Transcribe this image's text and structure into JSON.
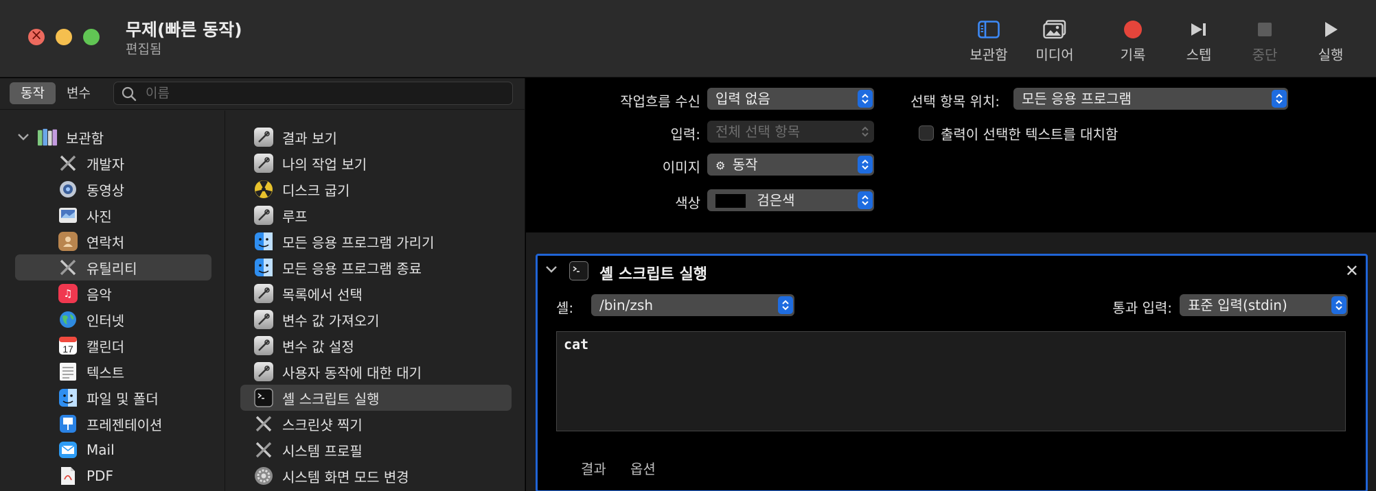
{
  "window": {
    "title": "무제(빠른 동작)",
    "subtitle": "편집됨"
  },
  "toolbar": {
    "library": "보관함",
    "media": "미디어",
    "record": "기록",
    "step": "스텝",
    "stop": "중단",
    "run": "실행"
  },
  "library": {
    "tabs": [
      "동작",
      "변수"
    ],
    "active_tab": "동작",
    "search_placeholder": "이름",
    "root_label": "보관함",
    "categories": [
      {
        "label": "개발자",
        "icon": "tools-icon"
      },
      {
        "label": "동영상",
        "icon": "movie-icon"
      },
      {
        "label": "사진",
        "icon": "photos-icon"
      },
      {
        "label": "연락처",
        "icon": "contacts-icon"
      },
      {
        "label": "유틸리티",
        "icon": "tools-icon",
        "selected": true
      },
      {
        "label": "음악",
        "icon": "music-icon"
      },
      {
        "label": "인터넷",
        "icon": "globe-icon"
      },
      {
        "label": "캘린더",
        "icon": "calendar-icon"
      },
      {
        "label": "텍스트",
        "icon": "text-icon"
      },
      {
        "label": "파일 및 폴더",
        "icon": "finder-icon"
      },
      {
        "label": "프레젠테이션",
        "icon": "keynote-icon"
      },
      {
        "label": "Mail",
        "icon": "mail-icon"
      },
      {
        "label": "PDF",
        "icon": "pdf-icon"
      }
    ],
    "calendar_day": "17",
    "actions": [
      {
        "label": "결과 보기",
        "icon": "automator-action-icon"
      },
      {
        "label": "나의 작업 보기",
        "icon": "automator-action-icon"
      },
      {
        "label": "디스크 굽기",
        "icon": "burn-icon"
      },
      {
        "label": "루프",
        "icon": "automator-action-icon"
      },
      {
        "label": "모든 응용 프로그램 가리기",
        "icon": "finder-icon"
      },
      {
        "label": "모든 응용 프로그램 종료",
        "icon": "finder-icon"
      },
      {
        "label": "목록에서 선택",
        "icon": "automator-action-icon"
      },
      {
        "label": "변수 값 가져오기",
        "icon": "automator-action-icon"
      },
      {
        "label": "변수 값 설정",
        "icon": "automator-action-icon"
      },
      {
        "label": "사용자 동작에 대한 대기",
        "icon": "automator-action-icon"
      },
      {
        "label": "셸 스크립트 실행",
        "icon": "terminal-icon",
        "selected": true
      },
      {
        "label": "스크린샷 찍기",
        "icon": "tools-icon"
      },
      {
        "label": "시스템 프로필",
        "icon": "tools-icon"
      },
      {
        "label": "시스템 화면 모드 변경",
        "icon": "system-prefs-icon"
      }
    ]
  },
  "workflow": {
    "receives_label": "작업흐름 수신",
    "receives_value": "입력 없음",
    "location_label": "선택 항목 위치:",
    "location_value": "모든 응용 프로그램",
    "input_label": "입력:",
    "input_value": "전체 선택 항목",
    "replace_label": "출력이 선택한 텍스트를 대치함",
    "image_label": "이미지",
    "image_value": "동작",
    "color_label": "색상",
    "color_value": "검은색"
  },
  "action": {
    "title": "셸 스크립트 실행",
    "shell_label": "셸:",
    "shell_value": "/bin/zsh",
    "pass_label": "통과 입력:",
    "pass_value": "표준 입력(stdin)",
    "script": "cat",
    "tab_results": "결과",
    "tab_options": "옵션"
  },
  "colors": {
    "accent": "#1e6ce0",
    "selection_border": "#2064d6",
    "close": "#ed6a5e",
    "minimize": "#f5bf4f",
    "maximize": "#61c554",
    "record": "#e5453b"
  }
}
